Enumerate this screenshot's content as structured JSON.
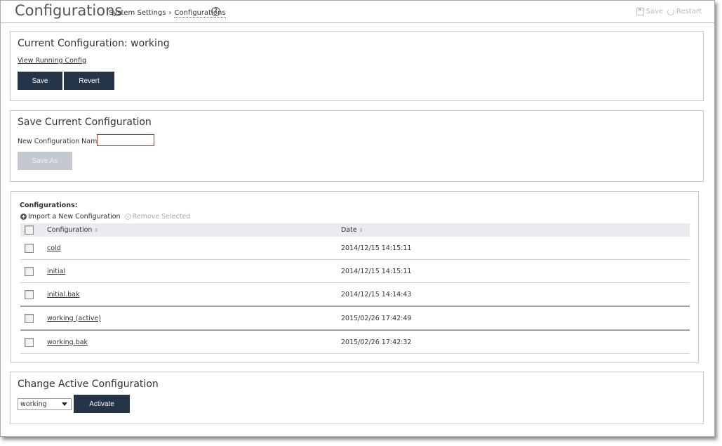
{
  "header": {
    "title": "Configurations",
    "breadcrumb": [
      "System Settings",
      "Configurations"
    ],
    "breadcrumb_sep": "›",
    "help_glyph": "?",
    "actions": {
      "save_label": "Save",
      "restart_label": "Restart"
    }
  },
  "current_config": {
    "heading": "Current Configuration: working",
    "view_link": "View Running Config",
    "save_label": "Save",
    "revert_label": "Revert"
  },
  "save_current": {
    "heading": "Save Current Configuration",
    "name_label": "New Configuration Name:",
    "name_value": "",
    "save_as_label": "Save As"
  },
  "configurations": {
    "label": "Configurations:",
    "import_label": "Import a New Configuration",
    "remove_label": "Remove Selected",
    "columns": [
      "Configuration",
      "Date"
    ],
    "sort_glyph": "⇕",
    "rows": [
      {
        "name": "cold",
        "date": "2014/12/15 14:15:11"
      },
      {
        "name": "initial",
        "date": "2014/12/15 14:15:11"
      },
      {
        "name": "initial.bak",
        "date": "2014/12/15 14:14:43"
      },
      {
        "name": "working (active)",
        "date": "2015/02/26 17:42:49"
      },
      {
        "name": "working.bak",
        "date": "2015/02/26 17:42:32"
      }
    ]
  },
  "change_active": {
    "heading": "Change Active Configuration",
    "selected": "working",
    "activate_label": "Activate"
  },
  "icons": {
    "plus": "+",
    "remove": "×"
  },
  "colors": {
    "button": "#253447",
    "input_border_error": "#b43a2e"
  }
}
